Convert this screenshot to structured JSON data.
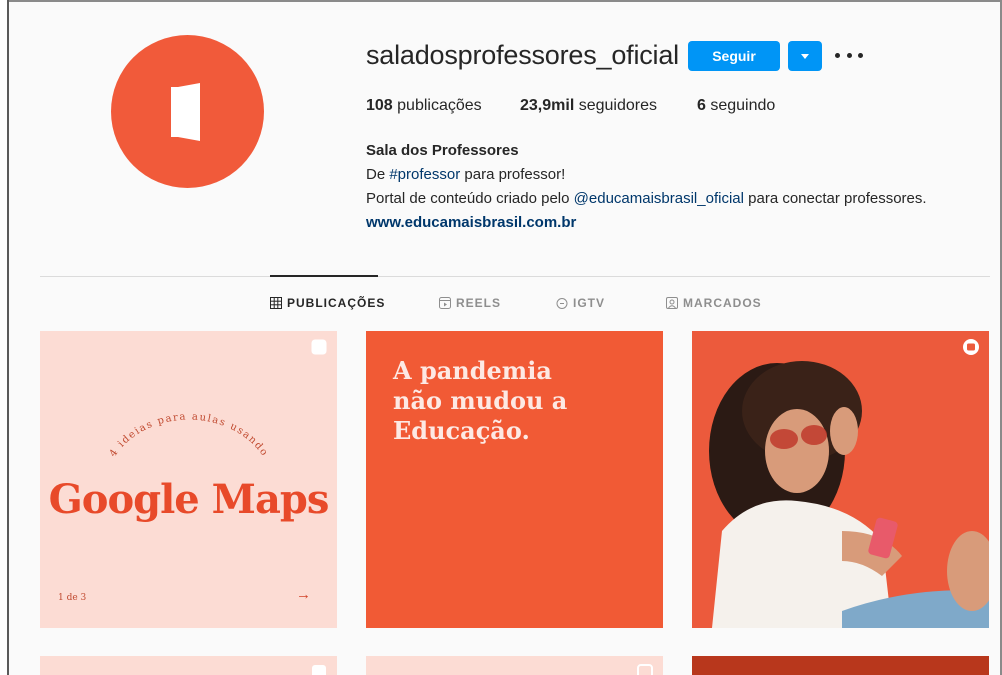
{
  "profile": {
    "username": "saladosprofessores_oficial",
    "follow_label": "Seguir",
    "stats": {
      "posts_count": "108",
      "posts_label": "publicações",
      "followers_count": "23,9mil",
      "followers_label": "seguidores",
      "following_count": "6",
      "following_label": "seguindo"
    },
    "bio": {
      "name": "Sala dos Professores",
      "line1_prefix": "De ",
      "line1_hashtag": "#professor",
      "line1_suffix": " para professor!",
      "line2_prefix": "Portal de conteúdo criado pelo ",
      "line2_mention": "@educamaisbrasil_oficial",
      "line2_suffix": " para conectar professores.",
      "website": "www.educamaisbrasil.com.br"
    }
  },
  "tabs": [
    {
      "label": "PUBLICAÇÕES",
      "icon": "grid-icon",
      "active": true
    },
    {
      "label": "REELS",
      "icon": "reels-icon",
      "active": false
    },
    {
      "label": "IGTV",
      "icon": "igtv-icon",
      "active": false
    },
    {
      "label": "MARCADOS",
      "icon": "tagged-icon",
      "active": false
    }
  ],
  "posts": [
    {
      "type": "carousel",
      "arc_text": "4 ideias para aulas usando",
      "title": "Google Maps",
      "page": "1 de 3",
      "arrow": "→"
    },
    {
      "type": "image",
      "text_lines": [
        "A pandemia",
        "não mudou a",
        "Educação."
      ]
    },
    {
      "type": "reel",
      "description": "photo-woman-sunglasses-phone"
    }
  ],
  "colors": {
    "brand": "#f15a3a",
    "follow_button": "#0095f6",
    "link": "#00376b"
  }
}
